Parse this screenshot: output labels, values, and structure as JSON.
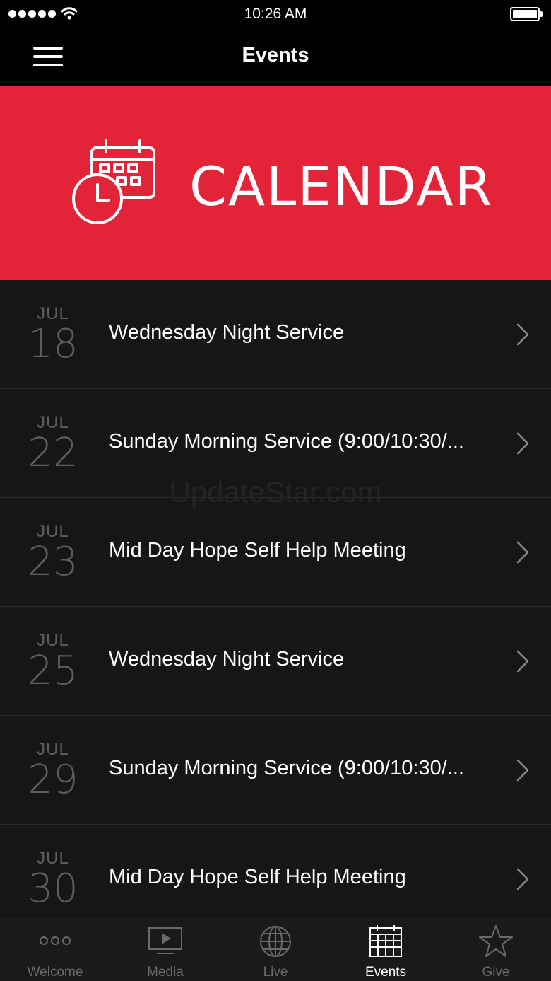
{
  "status_bar": {
    "time": "10:26 AM",
    "signal_icon": "signal-dots-icon",
    "wifi_icon": "wifi-icon",
    "battery_icon": "battery-icon"
  },
  "nav": {
    "title": "Events",
    "menu_icon": "hamburger-menu-icon"
  },
  "banner": {
    "text": "CALENDAR",
    "icon": "calendar-clock-icon",
    "background_color": "#e32438"
  },
  "events": [
    {
      "month": "JUL",
      "day": "18",
      "title": "Wednesday Night Service"
    },
    {
      "month": "JUL",
      "day": "22",
      "title": "Sunday Morning Service (9:00/10:30/..."
    },
    {
      "month": "JUL",
      "day": "23",
      "title": "Mid Day Hope Self Help Meeting"
    },
    {
      "month": "JUL",
      "day": "25",
      "title": "Wednesday Night Service"
    },
    {
      "month": "JUL",
      "day": "29",
      "title": "Sunday Morning Service (9:00/10:30/..."
    },
    {
      "month": "JUL",
      "day": "30",
      "title": "Mid Day Hope Self Help Meeting"
    }
  ],
  "watermark": "UpdateStar.com",
  "tabs": [
    {
      "label": "Welcome",
      "icon": "ellipsis-icon",
      "active": false
    },
    {
      "label": "Media",
      "icon": "play-screen-icon",
      "active": false
    },
    {
      "label": "Live",
      "icon": "globe-icon",
      "active": false
    },
    {
      "label": "Events",
      "icon": "calendar-icon",
      "active": true
    },
    {
      "label": "Give",
      "icon": "star-icon",
      "active": false
    }
  ]
}
